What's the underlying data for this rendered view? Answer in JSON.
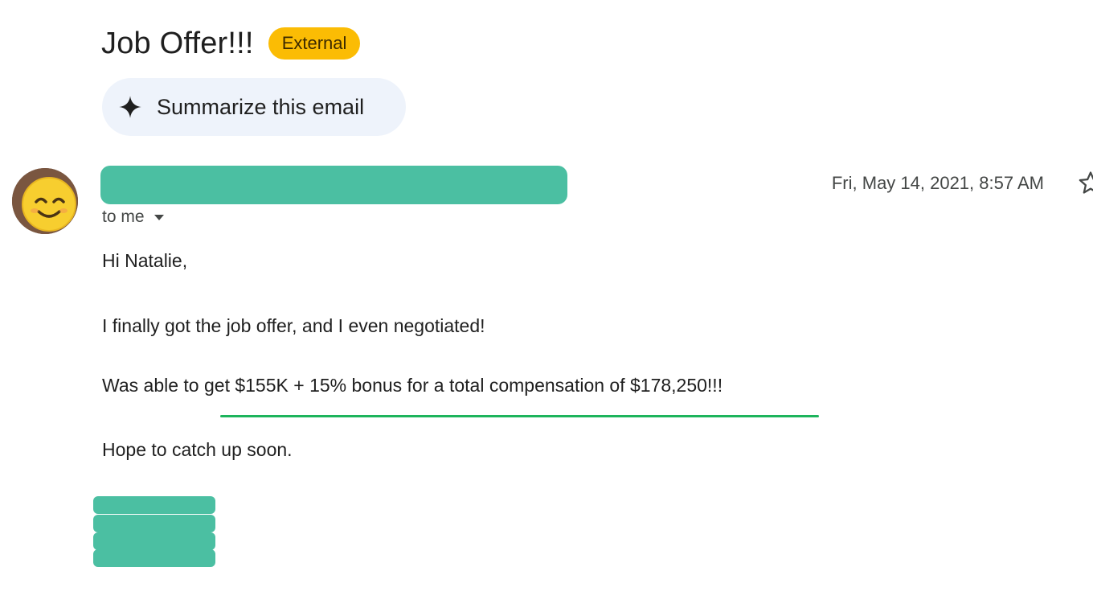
{
  "email": {
    "subject": "Job Offer!!!",
    "badge": "External",
    "summarize_label": "Summarize this email",
    "recipient_label": "to me",
    "timestamp": "Fri, May 14, 2021, 8:57 AM",
    "body": {
      "greeting": "Hi Natalie,",
      "line1": "I finally got the job offer, and I even negotiated!",
      "line2": "Was able to get $155K + 15% bonus for a total compensation of $178,250!!!",
      "closing": "Hope to catch up soon."
    }
  },
  "colors": {
    "badge": "#fbbc04",
    "summarize_bg": "#eef3fb",
    "redaction": "#4bbfa2",
    "underline": "#1db45c"
  },
  "icons": {
    "summarize": "sparkle-icon",
    "recipient_toggle": "caret-down-icon",
    "star": "star-icon",
    "avatar": "smiling-face-emoji"
  }
}
